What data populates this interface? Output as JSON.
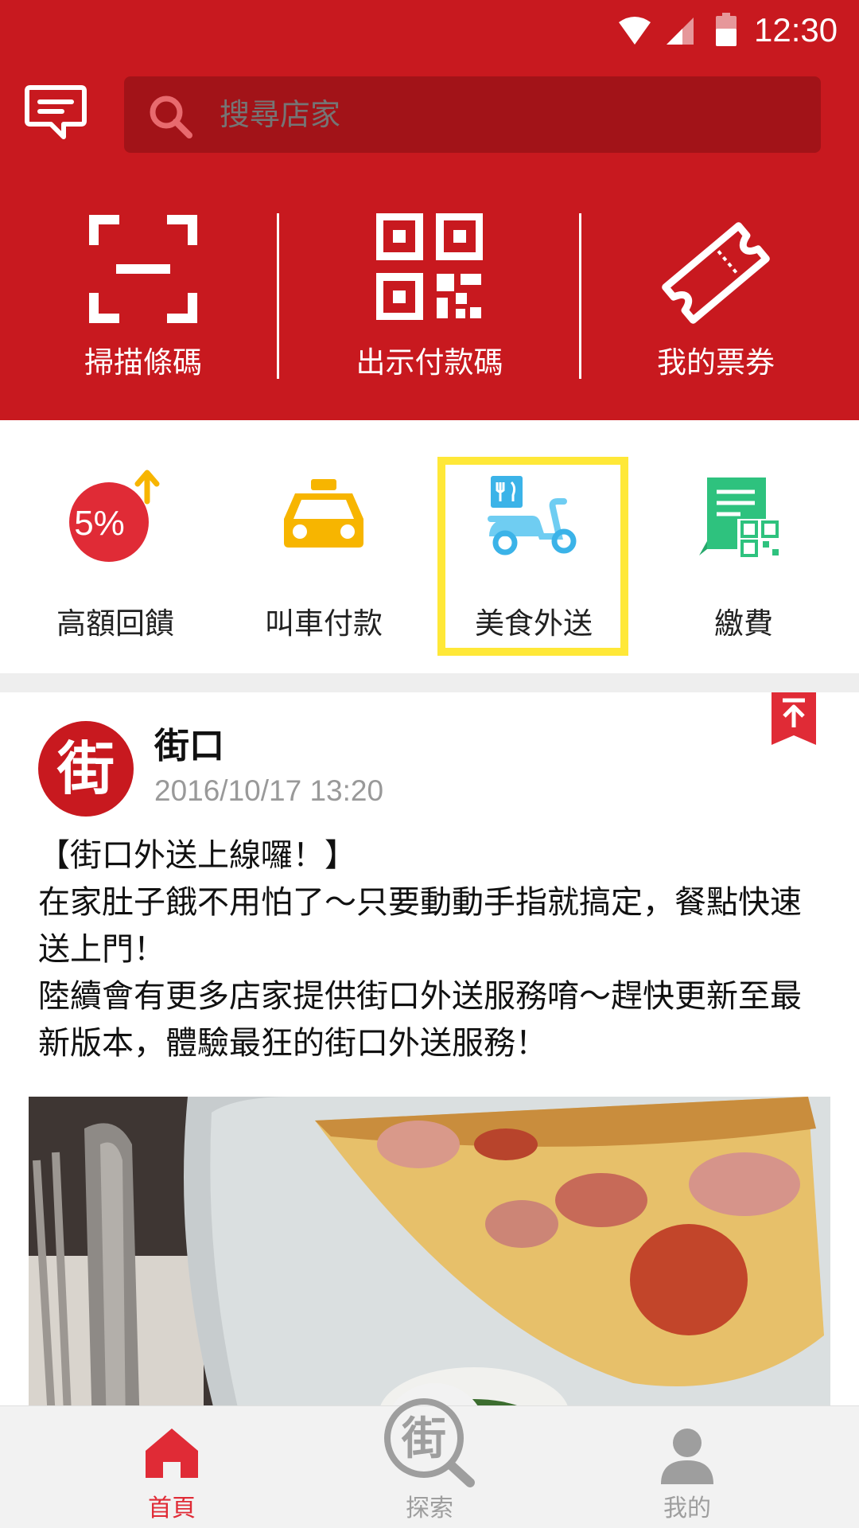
{
  "status_bar": {
    "time": "12:30"
  },
  "search": {
    "placeholder": "搜尋店家"
  },
  "quick_actions": [
    {
      "label": "掃描條碼",
      "icon": "scan-icon"
    },
    {
      "label": "出示付款碼",
      "icon": "qr-code-icon"
    },
    {
      "label": "我的票券",
      "icon": "ticket-icon"
    }
  ],
  "services": [
    {
      "label": "高額回饋",
      "icon": "cashback-5-percent-icon",
      "badge": "5%"
    },
    {
      "label": "叫車付款",
      "icon": "taxi-icon"
    },
    {
      "label": "美食外送",
      "icon": "food-delivery-scooter-icon",
      "highlighted": true
    },
    {
      "label": "繳費",
      "icon": "bill-qr-icon"
    }
  ],
  "post": {
    "avatar_char": "街",
    "author": "街口",
    "timestamp": "2016/10/17  13:20",
    "lines": [
      "【街口外送上線囉！】",
      "在家肚子餓不用怕了～只要動動手指就搞定，餐點快速送上門！",
      "陸續會有更多店家提供街口外送服務唷～趕快更新至最新版本，體驗最狂的街口外送服務！"
    ]
  },
  "bottom_nav": [
    {
      "label": "首頁",
      "icon": "home-icon",
      "active": true
    },
    {
      "label": "探索",
      "icon": "explore-search-icon",
      "active": false
    },
    {
      "label": "我的",
      "icon": "profile-icon",
      "active": false
    }
  ],
  "colors": {
    "brand_red": "#c8191f",
    "highlight": "#ffe838",
    "inactive": "#9e9e9e"
  }
}
